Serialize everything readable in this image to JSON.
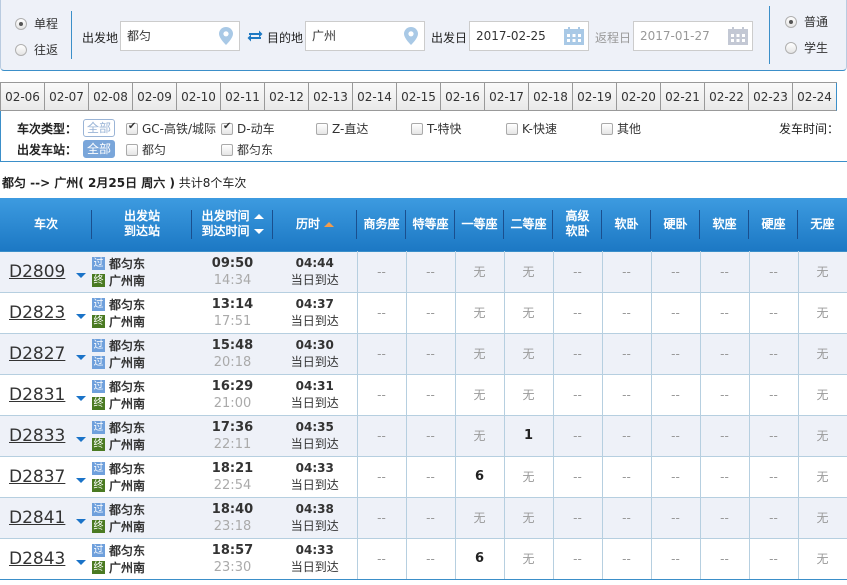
{
  "search": {
    "trip_type": [
      {
        "label": "单程",
        "selected": true
      },
      {
        "label": "往返",
        "selected": false
      }
    ],
    "from_label": "出发地",
    "from_value": "都匀",
    "to_label": "目的地",
    "to_value": "广州",
    "depart_date_label": "出发日",
    "depart_date_value": "2017-02-25",
    "return_date_label": "返程日",
    "return_date_value": "2017-01-27",
    "passenger_type": [
      {
        "label": "普通",
        "selected": true
      },
      {
        "label": "学生",
        "selected": false
      }
    ]
  },
  "date_tabs": [
    "02-06",
    "02-07",
    "02-08",
    "02-09",
    "02-10",
    "02-11",
    "02-12",
    "02-13",
    "02-14",
    "02-15",
    "02-16",
    "02-17",
    "02-18",
    "02-19",
    "02-20",
    "02-21",
    "02-22",
    "02-23",
    "02-24"
  ],
  "filters": {
    "train_type_label": "车次类型：",
    "train_type_all": "全部",
    "train_types": [
      {
        "label": "GC-高铁/城际",
        "checked": true
      },
      {
        "label": "D-动车",
        "checked": true
      },
      {
        "label": "Z-直达",
        "checked": false
      },
      {
        "label": "T-特快",
        "checked": false
      },
      {
        "label": "K-快速",
        "checked": false
      },
      {
        "label": "其他",
        "checked": false
      }
    ],
    "depart_time_label": "发车时间：",
    "station_label": "出发车站：",
    "station_all": "全部",
    "stations": [
      {
        "label": "都匀",
        "checked": false
      },
      {
        "label": "都匀东",
        "checked": false
      }
    ]
  },
  "summary": {
    "route": "都匀 --> 广州",
    "date": "( 2月25日  周六 )",
    "count": "共计8个车次"
  },
  "table": {
    "headers": {
      "train": "车次",
      "station_top": "出发站",
      "station_bottom": "到达站",
      "time_top": "出发时间",
      "time_bottom": "到达时间",
      "duration": "历时",
      "seats": [
        "商务座",
        "特等座",
        "一等座",
        "二等座",
        "高级\n软卧",
        "软卧",
        "硬卧",
        "软座",
        "硬座",
        "无座"
      ]
    },
    "rows": [
      {
        "train": "D2809",
        "from": "都匀东",
        "from_icon": "过",
        "to": "广州南",
        "to_icon": "终",
        "dep": "09:50",
        "arr": "14:34",
        "dur": "04:44",
        "arrive_note": "当日到达",
        "seats": [
          "--",
          "--",
          "无",
          "无",
          "--",
          "--",
          "--",
          "--",
          "--",
          "无"
        ]
      },
      {
        "train": "D2823",
        "from": "都匀东",
        "from_icon": "过",
        "to": "广州南",
        "to_icon": "终",
        "dep": "13:14",
        "arr": "17:51",
        "dur": "04:37",
        "arrive_note": "当日到达",
        "seats": [
          "--",
          "--",
          "无",
          "无",
          "--",
          "--",
          "--",
          "--",
          "--",
          "无"
        ]
      },
      {
        "train": "D2827",
        "from": "都匀东",
        "from_icon": "过",
        "to": "广州南",
        "to_icon": "过",
        "dep": "15:48",
        "arr": "20:18",
        "dur": "04:30",
        "arrive_note": "当日到达",
        "seats": [
          "--",
          "--",
          "无",
          "无",
          "--",
          "--",
          "--",
          "--",
          "--",
          "无"
        ]
      },
      {
        "train": "D2831",
        "from": "都匀东",
        "from_icon": "过",
        "to": "广州南",
        "to_icon": "终",
        "dep": "16:29",
        "arr": "21:00",
        "dur": "04:31",
        "arrive_note": "当日到达",
        "seats": [
          "--",
          "--",
          "无",
          "无",
          "--",
          "--",
          "--",
          "--",
          "--",
          "无"
        ]
      },
      {
        "train": "D2833",
        "from": "都匀东",
        "from_icon": "过",
        "to": "广州南",
        "to_icon": "终",
        "dep": "17:36",
        "arr": "22:11",
        "dur": "04:35",
        "arrive_note": "当日到达",
        "seats": [
          "--",
          "--",
          "无",
          "1",
          "--",
          "--",
          "--",
          "--",
          "--",
          "无"
        ]
      },
      {
        "train": "D2837",
        "from": "都匀东",
        "from_icon": "过",
        "to": "广州南",
        "to_icon": "终",
        "dep": "18:21",
        "arr": "22:54",
        "dur": "04:33",
        "arrive_note": "当日到达",
        "seats": [
          "--",
          "--",
          "6",
          "无",
          "--",
          "--",
          "--",
          "--",
          "--",
          "无"
        ]
      },
      {
        "train": "D2841",
        "from": "都匀东",
        "from_icon": "过",
        "to": "广州南",
        "to_icon": "终",
        "dep": "18:40",
        "arr": "23:18",
        "dur": "04:38",
        "arrive_note": "当日到达",
        "seats": [
          "--",
          "--",
          "无",
          "无",
          "--",
          "--",
          "--",
          "--",
          "--",
          "无"
        ]
      },
      {
        "train": "D2843",
        "from": "都匀东",
        "from_icon": "过",
        "to": "广州南",
        "to_icon": "终",
        "dep": "18:57",
        "arr": "23:30",
        "dur": "04:33",
        "arrive_note": "当日到达",
        "seats": [
          "--",
          "--",
          "6",
          "无",
          "--",
          "--",
          "--",
          "--",
          "--",
          "无"
        ]
      }
    ]
  },
  "colors": {
    "accent_blue": "#3b8fc9",
    "header_blue": "#1c78c4",
    "row_alt": "#eef1f8",
    "pass_icon": "#6fa0dc",
    "end_icon": "#4a7a22",
    "sort_active": "#f39c4b"
  }
}
